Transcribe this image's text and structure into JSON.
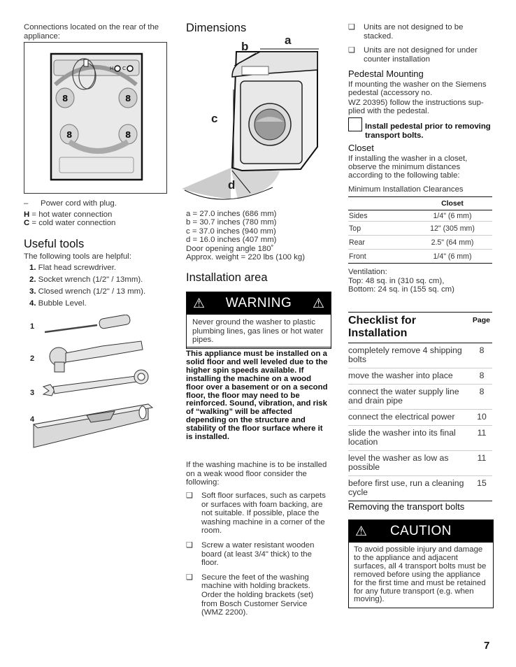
{
  "page_number": "7",
  "column1": {
    "intro": "Connections located on the rear of the appliance:",
    "figure": "rear-of-appliance-illustration",
    "legend": [
      {
        "key": "–",
        "text": "Power cord with plug."
      },
      {
        "key": "H",
        "text": "= hot water connection"
      },
      {
        "key": "C",
        "text": "= cold water connection"
      }
    ],
    "useful_tools": {
      "heading": "Useful tools",
      "intro": "The following tools are helpful:",
      "items": [
        {
          "num": "1.",
          "text": "Flat head screwdriver."
        },
        {
          "num": "2.",
          "text": "Socket wrench (1/2\" / 13mm)."
        },
        {
          "num": "3.",
          "text": "Closed wrench (1/2\" / 13 mm)."
        },
        {
          "num": "4.",
          "text": "Bubble Level."
        }
      ],
      "figure_labels": [
        "1",
        "2",
        "3",
        "4"
      ]
    }
  },
  "column2": {
    "dimensions": {
      "heading": "Dimensions",
      "figure_labels": {
        "a": "a",
        "b": "b",
        "c": "c",
        "d": "d"
      },
      "lines": [
        "a = 27.0 inches (686 mm)",
        "b = 30.7 inches (780 mm)",
        "c = 37.0 inches (940 mm)",
        "d = 16.0 inches (407 mm)",
        "Door opening angle 180˚",
        "Approx. weight = 220 lbs (100 kg)"
      ]
    },
    "installation_area": {
      "heading": "Installation area",
      "warning_title": "WARNING",
      "warning_text": "Never ground the washer to plastic plumbing lines, gas lines or hot water pipes.",
      "bold_paragraph": "This appliance must be installed on a solid floor and well leveled due to the higher spin speeds available. If installing the machine on a wood floor over a basement or on a second floor, the floor may need to be reinforced. Sound, vibration, and risk of “walking” will be affected depending on the structure and stability of the floor surface where it is installed.",
      "weak_floor_intro": "If the washing machine is to be installed on a weak wood floor consider the following:",
      "weak_floor_items": [
        "Soft floor surfaces, such as carpets or surfaces with foam backing, are not suitable. If possible, place the washing machine in a corner of the room.",
        "Screw a water resistant wooden board (at least 3/4\" thick) to the floor.",
        "Secure the feet of the washing machine with holding brackets. Order the holding brackets (set) from Bosch Customer Service (WMZ 2200)."
      ]
    }
  },
  "column3": {
    "notes": [
      "Units are not designed to be stacked.",
      "Units are not designed for under counter installation"
    ],
    "pedestal": {
      "heading": "Pedestal Mounting",
      "text1": "If mounting the washer on the Siemens pedestal (accessory no.",
      "text2": "WZ 20395) follow the instructions sup-plied with the pedestal.",
      "note": "Install pedestal prior to removing transport bolts."
    },
    "closet": {
      "heading": "Closet",
      "text": "If installing the washer in a closet, observe the minimum distances according to the following table:",
      "table_title": "Minimum Installation Clearances",
      "table_header": [
        "",
        "Closet"
      ],
      "table_rows": [
        [
          "Sides",
          "1/4\" (6 mm)"
        ],
        [
          "Top",
          "12\" (305 mm)"
        ],
        [
          "Rear",
          "2.5\" (64 mm)"
        ],
        [
          "Front",
          "1/4\" (6 mm)"
        ]
      ],
      "ventilation": [
        "Ventilation:",
        "Top: 48 sq. in (310 sq. cm),",
        "Bottom: 24 sq. in (155 sq. cm)"
      ]
    },
    "checklist": {
      "title": "Checklist for Installation",
      "page_header": "Page",
      "rows": [
        {
          "task": "completely remove 4 shipping bolts",
          "page": "8"
        },
        {
          "task": "move the washer into place",
          "page": "8"
        },
        {
          "task": "connect the water supply line and drain pipe",
          "page": "8"
        },
        {
          "task": "connect the electrical power",
          "page": "10"
        },
        {
          "task": "slide the washer into its final location",
          "page": "11"
        },
        {
          "task": "level the washer as low as possible",
          "page": "11"
        },
        {
          "task": "before first use, run a cleaning cycle",
          "page": "15"
        }
      ]
    },
    "transport_bolts": {
      "heading": "Removing the transport bolts",
      "caution_title": "CAUTION",
      "caution_text": "To avoid possible injury and damage to the appliance and adjacent surfaces, all 4 transport bolts must be removed before using the appliance for the first time and must be retained for any future transport (e.g. when moving)."
    }
  }
}
